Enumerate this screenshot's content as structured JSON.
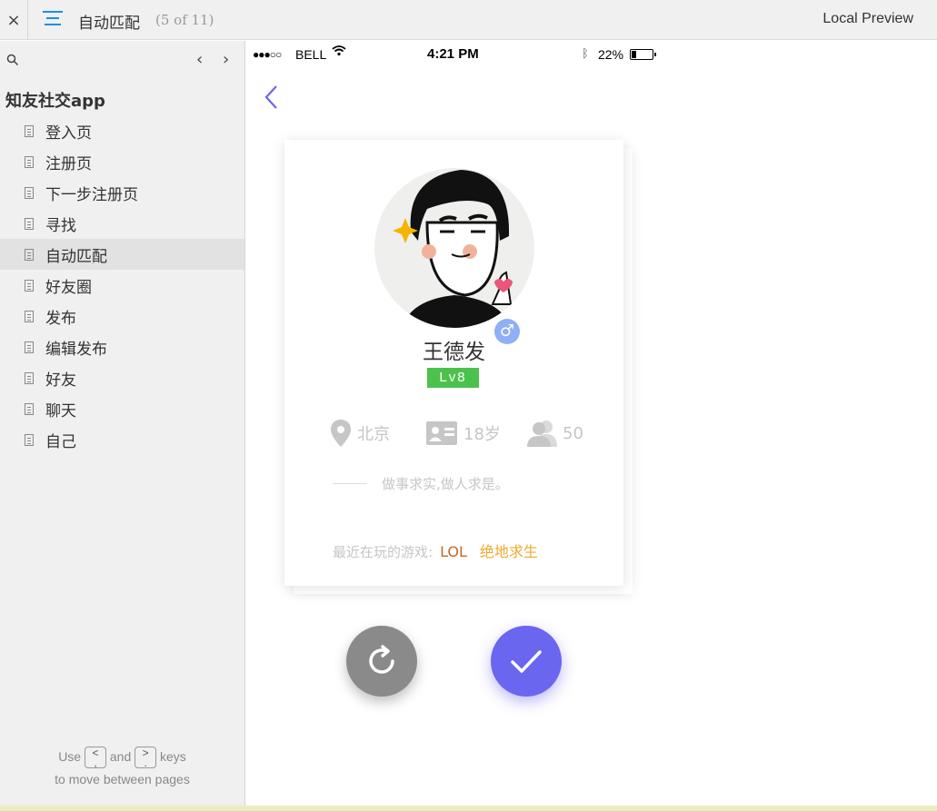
{
  "topbar": {
    "close_label": "×",
    "page_title": "自动匹配",
    "page_count": "(5 of 11)",
    "preview_label": "Local Preview"
  },
  "sidebar": {
    "project_title": "知友社交app",
    "items": [
      {
        "label": "登入页"
      },
      {
        "label": "注册页"
      },
      {
        "label": "下一步注册页"
      },
      {
        "label": "寻找"
      },
      {
        "label": "自动匹配"
      },
      {
        "label": "好友圈"
      },
      {
        "label": "发布"
      },
      {
        "label": "编辑发布"
      },
      {
        "label": "好友"
      },
      {
        "label": "聊天"
      },
      {
        "label": "自己"
      }
    ],
    "active_index": 4,
    "hint": {
      "use": "Use",
      "and": "and",
      "keys": "keys",
      "line2": "to move between pages",
      "key_prev": "<\n,",
      "key_next": ">\n."
    }
  },
  "status_bar": {
    "signal": "●●●○○",
    "carrier": "BELL",
    "time": "4:21 PM",
    "battery": "22%",
    "battery_level": 0.22
  },
  "profile": {
    "name": "王德发",
    "gender_symbol": "♂",
    "level": "Lv8",
    "location": "北京",
    "age": "18岁",
    "friends": "50",
    "motto": "做事求实,做人求是。",
    "games_label": "最近在玩的游戏:",
    "games": [
      "LOL",
      "绝地求生"
    ]
  },
  "colors": {
    "accent": "#6a66f0",
    "level_green": "#4cc24c",
    "gender_blue": "#8fb0f5",
    "game_1": "#c0692a",
    "game_2": "#f0a830"
  }
}
